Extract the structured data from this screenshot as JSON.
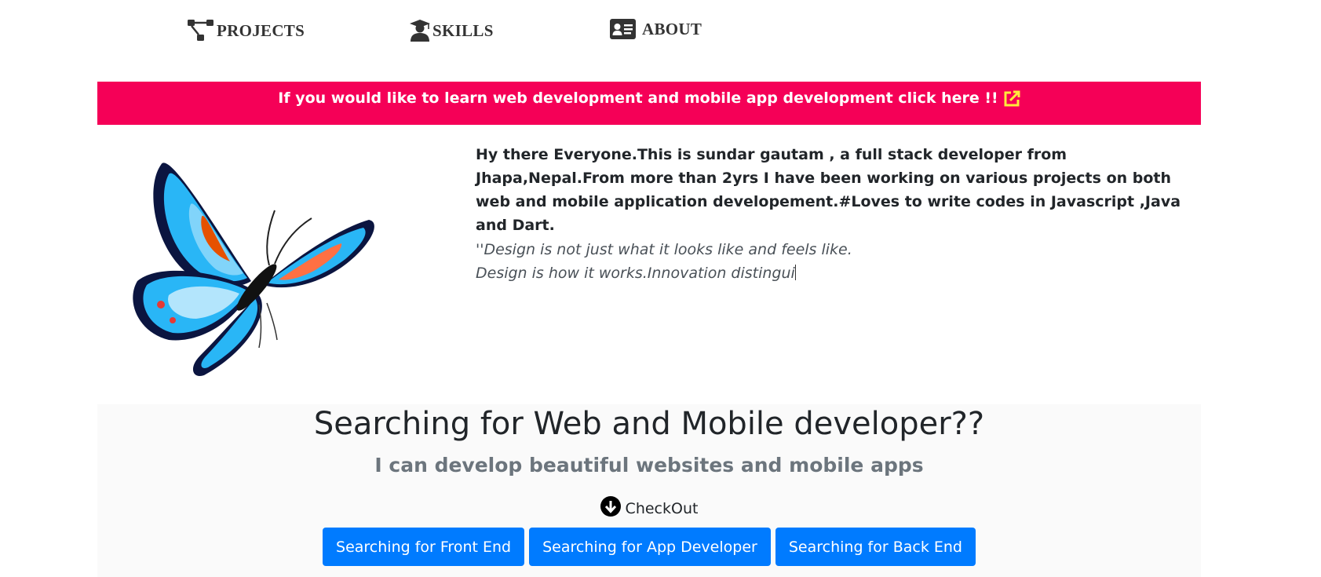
{
  "nav": {
    "items": [
      {
        "label": "PROJECTS",
        "icon": "project-diagram-icon"
      },
      {
        "label": "SKILLS",
        "icon": "user-graduate-icon"
      },
      {
        "label": "ABOUT",
        "icon": "id-card-icon"
      }
    ]
  },
  "banner": {
    "text": "If you would like to learn web development and mobile app development click here !!",
    "icon": "external-link-icon",
    "background": "#f50057",
    "icon_color": "#ffeb3b"
  },
  "intro": {
    "image": "butterfly-illustration",
    "bio": "Hy there Everyone.This is sundar gautam , a full stack developer from Jhapa,Nepal.From more than 2yrs I have been working on various projects on both web and mobile application developement.#Loves to write codes in Javascript ,Java and Dart.",
    "quote_line1": "''Design is not just what it looks like and feels like.",
    "quote_line2": "Design is how it works.Innovation distingui"
  },
  "jumbotron": {
    "title": "Searching for Web and Mobile developer??",
    "subtitle": "I can develop beautiful websites and mobile apps",
    "checkout_label": "CheckOut",
    "buttons": [
      {
        "label": "Searching for Front End"
      },
      {
        "label": "Searching for App Developer"
      },
      {
        "label": "Searching for Back End"
      }
    ],
    "button_color": "#007bff"
  }
}
